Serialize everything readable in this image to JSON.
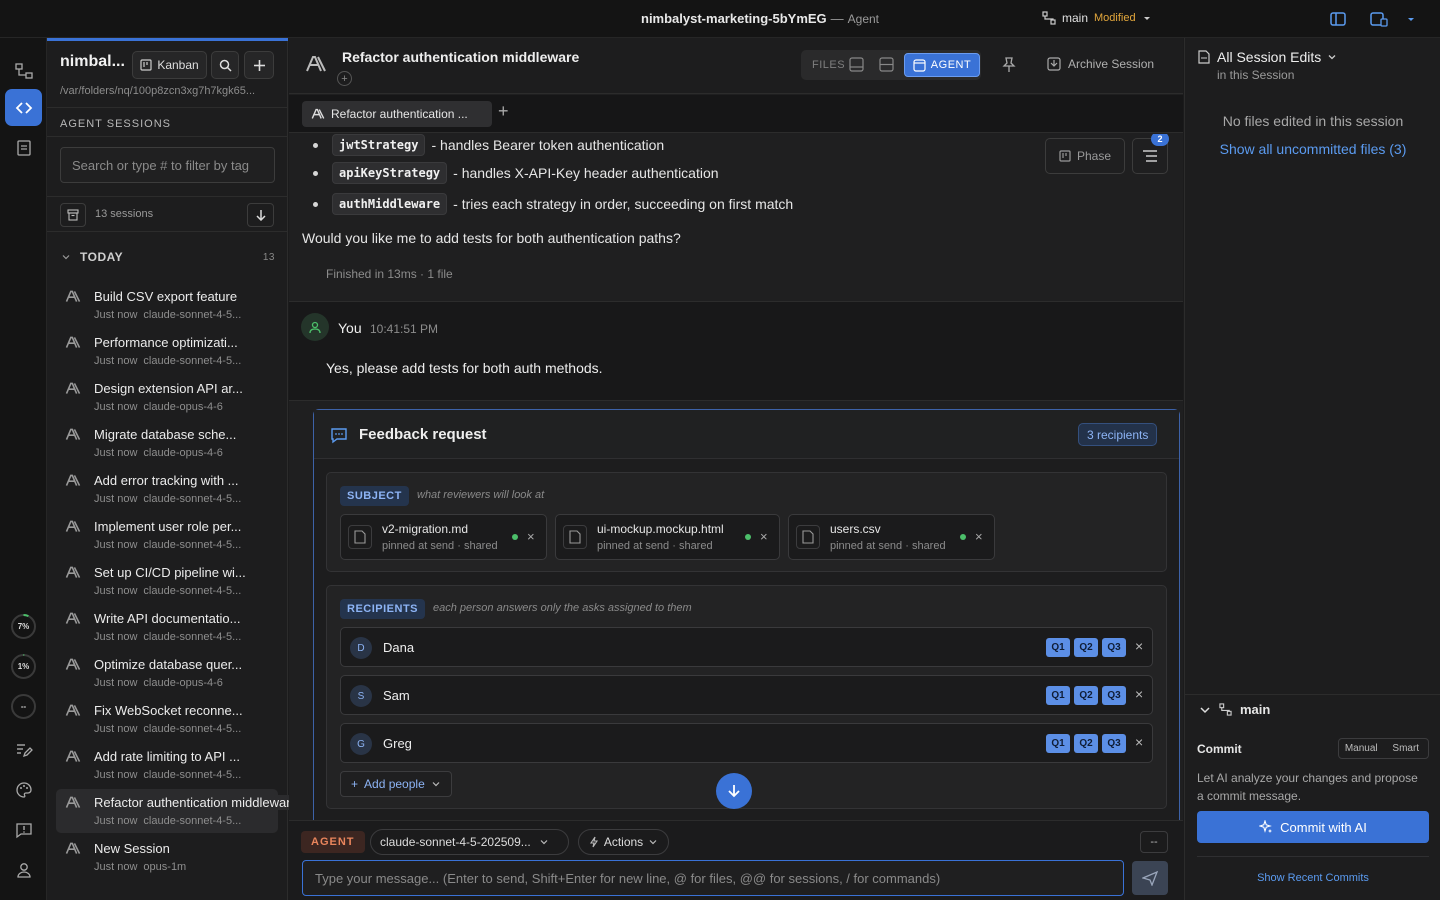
{
  "window": {
    "title": "nimbalyst-marketing-5bYmEG",
    "separator": "—",
    "mode": "Agent",
    "branch": "main",
    "branch_status": "Modified"
  },
  "sidebar": {
    "workspace_name": "nimbal...",
    "kanban_label": "Kanban",
    "path": "/var/folders/nq/100p8zcn3xg7h7kgk65...",
    "sessions_header": "AGENT SESSIONS",
    "filter_placeholder": "Search or type # to filter by tag",
    "session_count": "13 sessions",
    "group_label": "TODAY",
    "group_count": "13",
    "sessions": [
      {
        "title": "Build CSV export feature",
        "time": "Just now",
        "model": "claude-sonnet-4-5..."
      },
      {
        "title": "Performance optimizati...",
        "time": "Just now",
        "model": "claude-sonnet-4-5..."
      },
      {
        "title": "Design extension API ar...",
        "time": "Just now",
        "model": "claude-opus-4-6"
      },
      {
        "title": "Migrate database sche...",
        "time": "Just now",
        "model": "claude-opus-4-6"
      },
      {
        "title": "Add error tracking with ...",
        "time": "Just now",
        "model": "claude-sonnet-4-5..."
      },
      {
        "title": "Implement user role per...",
        "time": "Just now",
        "model": "claude-sonnet-4-5..."
      },
      {
        "title": "Set up CI/CD pipeline wi...",
        "time": "Just now",
        "model": "claude-sonnet-4-5..."
      },
      {
        "title": "Write API documentatio...",
        "time": "Just now",
        "model": "claude-sonnet-4-5..."
      },
      {
        "title": "Optimize database quer...",
        "time": "Just now",
        "model": "claude-opus-4-6"
      },
      {
        "title": "Fix WebSocket reconne...",
        "time": "Just now",
        "model": "claude-sonnet-4-5..."
      },
      {
        "title": "Add rate limiting to API ...",
        "time": "Just now",
        "model": "claude-sonnet-4-5..."
      },
      {
        "title": "Refactor authentication middleware",
        "time": "Just now",
        "model": "claude-sonnet-4-5..."
      },
      {
        "title": "New Session",
        "time": "Just now",
        "model": "opus-1m"
      }
    ]
  },
  "rail": {
    "usage": [
      {
        "label": "7%",
        "fraction": 0.07
      },
      {
        "label": "1%",
        "fraction": 0.01
      },
      {
        "label": "--",
        "fraction": 0
      }
    ]
  },
  "main": {
    "title": "Refactor authentication middleware",
    "files_label": "FILES",
    "agent_label": "AGENT",
    "archive_label": "Archive Session",
    "tab_label": "Refactor authentication ...",
    "phase_label": "Phase",
    "todo_badge": "2",
    "bullets": [
      {
        "code": "jwtStrategy",
        "text": "- handles Bearer token authentication"
      },
      {
        "code": "apiKeyStrategy",
        "text": "- handles X-API-Key header authentication"
      },
      {
        "code": "authMiddleware",
        "text": "- tries each strategy in order, succeeding on first match"
      }
    ],
    "question": "Would you like me to add tests for both authentication paths?",
    "finished": "Finished in 13ms · 1 file",
    "user": {
      "name": "You",
      "time": "10:41:51 PM",
      "text": "Yes, please add tests for both auth methods."
    },
    "feedback": {
      "title": "Feedback request",
      "recipients_badge": "3 recipients",
      "subject_label": "SUBJECT",
      "subject_hint": "what reviewers will look at",
      "files": [
        {
          "name": "v2-migration.md",
          "status": "pinned at send · shared"
        },
        {
          "name": "ui-mockup.mockup.html",
          "status": "pinned at send · shared"
        },
        {
          "name": "users.csv",
          "status": "pinned at send · shared"
        }
      ],
      "recipients_label": "RECIPIENTS",
      "recipients_hint": "each person answers only the asks assigned to them",
      "recipients": [
        {
          "initial": "D",
          "name": "Dana",
          "asks": [
            "Q1",
            "Q2",
            "Q3"
          ]
        },
        {
          "initial": "S",
          "name": "Sam",
          "asks": [
            "Q1",
            "Q2",
            "Q3"
          ]
        },
        {
          "initial": "G",
          "name": "Greg",
          "asks": [
            "Q1",
            "Q2",
            "Q3"
          ]
        }
      ],
      "add_people": "Add people"
    },
    "composer": {
      "agent_pill": "AGENT",
      "model": "claude-sonnet-4-5-202509...",
      "actions": "Actions",
      "dash": "--",
      "placeholder": "Type your message... (Enter to send, Shift+Enter for new line, @ for files, @@ for sessions, / for commands)"
    }
  },
  "right": {
    "title": "All Session Edits",
    "subtitle": "in this Session",
    "empty": "No files edited in this session",
    "show_uncommitted": "Show all uncommitted files (3)",
    "branch": "main",
    "commit_label": "Commit",
    "toggle_manual": "Manual",
    "toggle_smart": "Smart",
    "commit_desc": "Let AI analyze your changes and propose a commit message.",
    "commit_ai": "Commit with AI",
    "recent_commits": "Show Recent Commits"
  },
  "colors": {
    "accent": "#3a72d6",
    "modified": "#e3a73c",
    "agent_pill": "#e9855c",
    "link": "#5b9bf0"
  }
}
